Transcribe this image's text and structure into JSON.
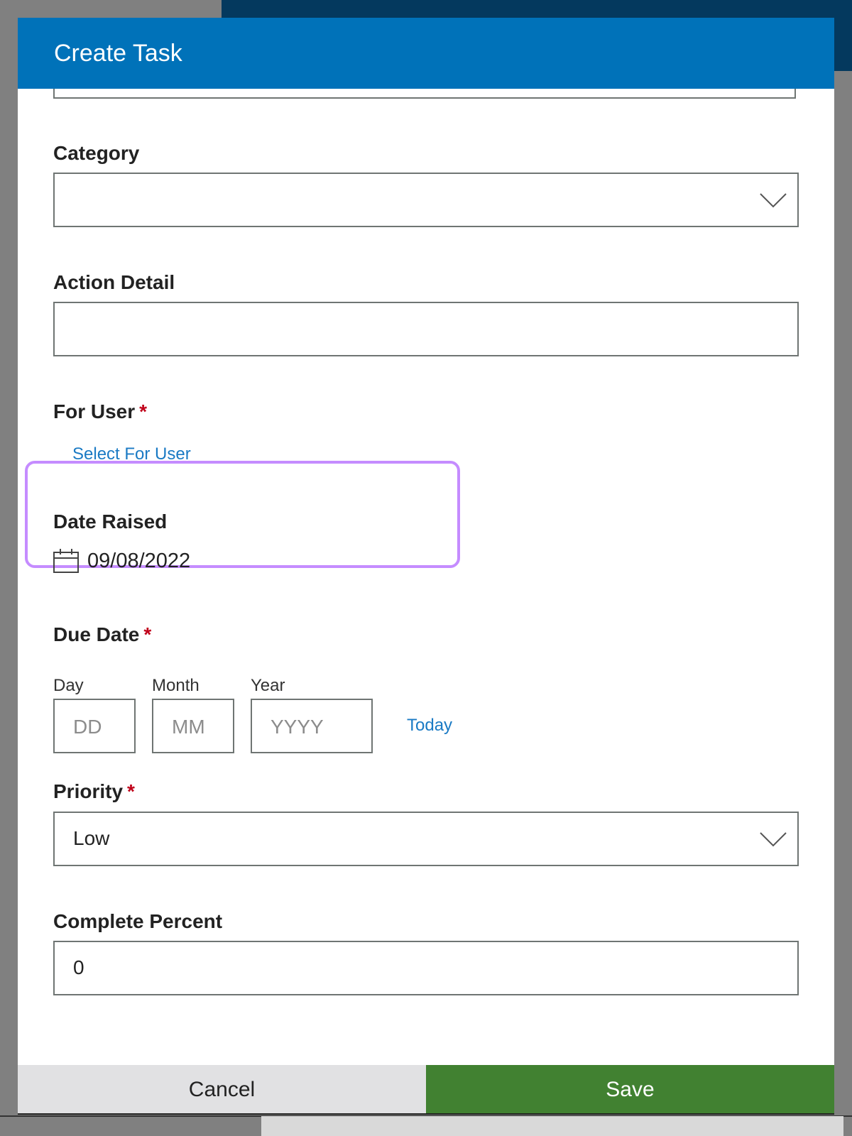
{
  "dialog": {
    "title": "Create Task"
  },
  "form": {
    "category": {
      "label": "Category",
      "value": ""
    },
    "action_detail": {
      "label": "Action Detail",
      "value": ""
    },
    "for_user": {
      "label": "For User",
      "required_mark": "*",
      "link": "Select For User"
    },
    "date_raised": {
      "label": "Date Raised",
      "value": "09/08/2022",
      "icon": "calendar-icon"
    },
    "due_date": {
      "label": "Due Date",
      "required_mark": "*",
      "day_label": "Day",
      "day_placeholder": "DD",
      "month_label": "Month",
      "month_placeholder": "MM",
      "year_label": "Year",
      "year_placeholder": "YYYY",
      "today_link": "Today"
    },
    "priority": {
      "label": "Priority",
      "required_mark": "*",
      "value": "Low"
    },
    "complete_percent": {
      "label": "Complete Percent",
      "value": "0"
    }
  },
  "footer": {
    "cancel_label": "Cancel",
    "save_label": "Save"
  },
  "colors": {
    "header": "#0072b9",
    "save": "#418131",
    "link": "#1a7ac4",
    "required": "#c0001a",
    "highlight": "#c58cff"
  }
}
